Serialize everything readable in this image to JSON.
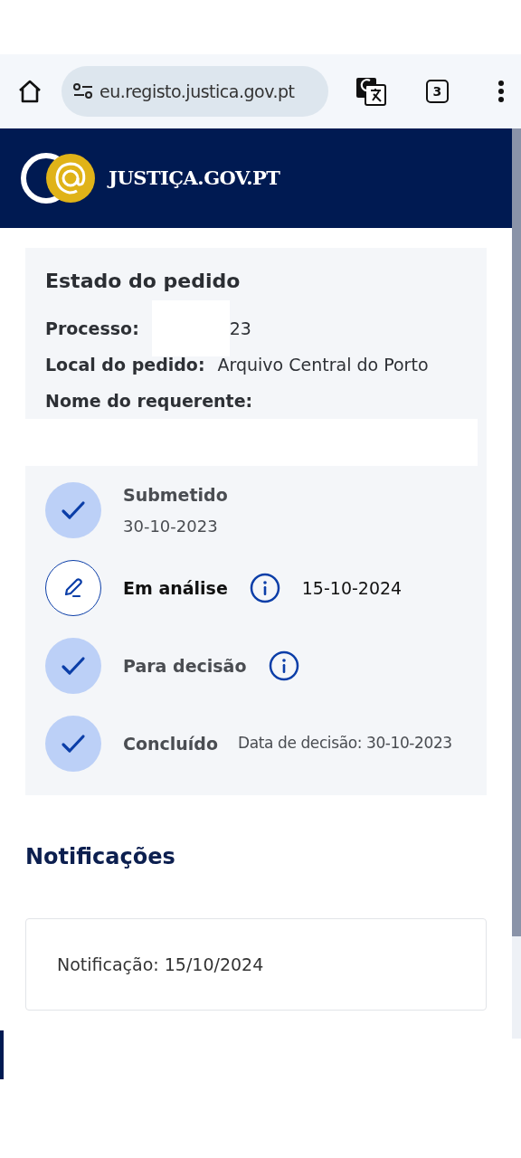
{
  "browser": {
    "url": "eu.registo.justica.gov.pt",
    "tab_count": "3"
  },
  "header": {
    "site_name": "JUSTIÇA.GOV.PT"
  },
  "request": {
    "title": "Estado do pedido",
    "fields": [
      {
        "label": "Processo:",
        "value": "23",
        "redacted": true
      },
      {
        "label": "Local do pedido:",
        "value": "Arquivo Central do Porto",
        "redacted": false
      },
      {
        "label": "Nome do requerente:",
        "redacted": true
      }
    ],
    "steps": [
      {
        "label": "Submetido",
        "subtitle": "30-10-2023",
        "kind": "done",
        "info": false
      },
      {
        "label": "Em análise",
        "date": "15-10-2024",
        "kind": "current",
        "info": true
      },
      {
        "label": "Para decisão",
        "kind": "done",
        "info": true
      },
      {
        "label": "Concluído",
        "date": "Data de decisão: 30-10-2023",
        "kind": "done",
        "info": false
      }
    ]
  },
  "notifications": {
    "title": "Notificações",
    "items": [
      "Notificação: 15/10/2024"
    ]
  }
}
